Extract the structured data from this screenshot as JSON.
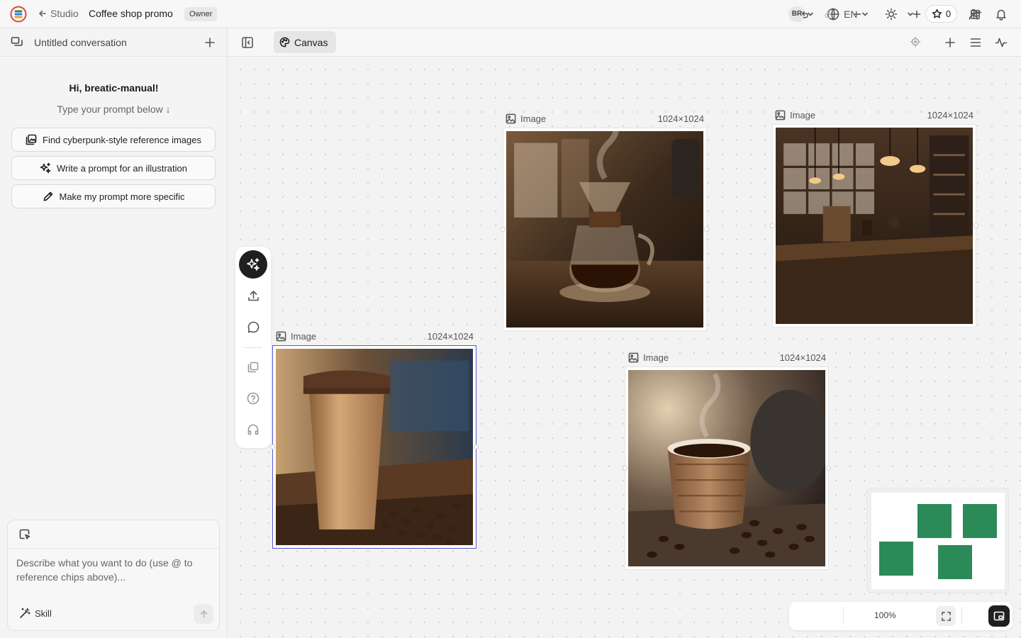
{
  "topbar": {
    "back_label": "Studio",
    "project_name": "Coffee shop promo",
    "role_badge": "Owner",
    "user_initials": "BR",
    "language": "EN",
    "stars_count": "0"
  },
  "sidebar": {
    "conversation_title": "Untitled conversation",
    "greeting": "Hi, breatic-manual!",
    "subtitle": "Type your prompt below ↓",
    "suggestions": [
      "Find cyberpunk-style reference images",
      "Write a prompt for an illustration",
      "Make my prompt more specific"
    ],
    "composer": {
      "placeholder": "Describe what you want to do (use @ to reference chips above)...",
      "skill_label": "Skill"
    }
  },
  "canvas_toolbar": {
    "tab_label": "Canvas"
  },
  "canvas": {
    "nodes": [
      {
        "type_label": "Image",
        "size": "1024×1024",
        "subject": "pour-over coffee maker"
      },
      {
        "type_label": "Image",
        "size": "1024×1024",
        "subject": "coffee shop interior"
      },
      {
        "type_label": "Image",
        "size": "1024×1024",
        "subject": "paper coffee cup with beans"
      },
      {
        "type_label": "Image",
        "size": "1024×1024",
        "subject": "espresso cup with beans"
      }
    ]
  },
  "zoom": {
    "level": "100%"
  },
  "colors": {
    "minimap_node": "#2c8a58",
    "selection": "#5b57d6",
    "active_tool": "#1f1f1f"
  }
}
